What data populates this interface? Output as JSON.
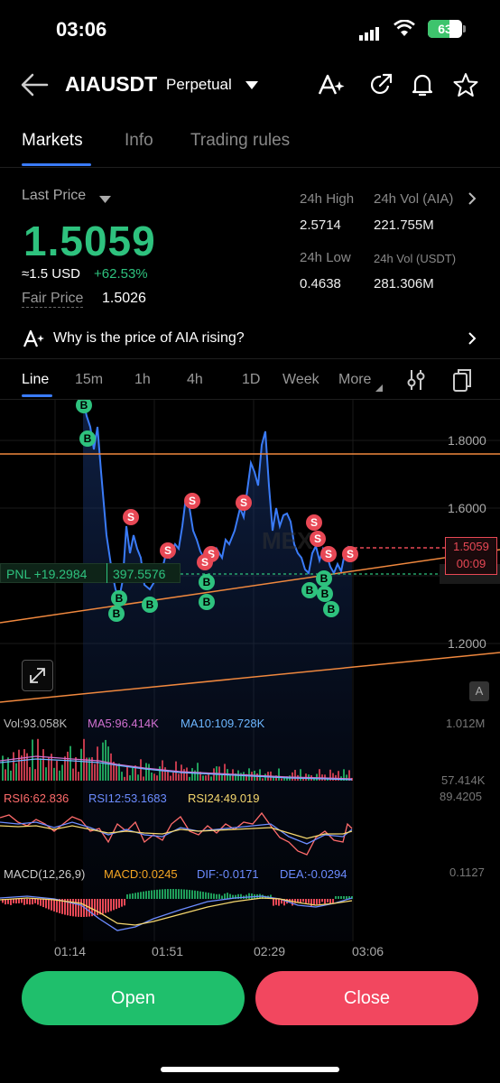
{
  "status": {
    "time": "03:06",
    "battery": "63",
    "battery_level": 0.63
  },
  "header": {
    "symbol": "AIAUSDT",
    "contract_type": "Perpetual"
  },
  "tabs": [
    "Markets",
    "Info",
    "Trading rules"
  ],
  "market": {
    "last_price_label": "Last Price",
    "last_price": "1.5059",
    "approx_usd": "≈1.5  USD",
    "change_pct": "+62.53%",
    "fair_price_label": "Fair Price",
    "fair_price": "1.5026",
    "high_label": "24h High",
    "high": "2.5714",
    "low_label": "24h Low",
    "low": "0.4638",
    "vol_aia_label": "24h Vol (AIA)",
    "vol_aia": "221.755M",
    "vol_usdt_label": "24h Vol  (USDT)",
    "vol_usdt": "281.306M"
  },
  "why_banner": "Why is the price of AIA rising?",
  "intervals": [
    "Line",
    "15m",
    "1h",
    "4h",
    "1D",
    "Week",
    "More"
  ],
  "chart": {
    "price_axis": [
      "1.8000",
      "1.6000",
      "1.2000"
    ],
    "price_tag_top": "1.5059",
    "price_tag_bottom": "00:09",
    "pnl": "PNL +19.2984",
    "entry_price": "397.5576",
    "mode_badge": "A",
    "vol_header": {
      "vol": "Vol:93.058K",
      "ma5": "MA5:96.414K",
      "ma10": "MA10:109.728K"
    },
    "vol_axis_top": "1.012M",
    "vol_axis_bottom": "57.414K",
    "rsi_header": {
      "rsi6": "RSI6:62.836",
      "rsi12": "RSI12:53.1683",
      "rsi24": "RSI24:49.019"
    },
    "rsi_axis_top": "89.4205",
    "macd_header": {
      "name": "MACD(12,26,9)",
      "macd": "MACD:0.0245",
      "dif": "DIF:-0.0171",
      "dea": "DEA:-0.0294"
    },
    "macd_axis_top": "0.1127",
    "time_axis": [
      "01:14",
      "01:51",
      "02:29",
      "03:06"
    ],
    "colors": {
      "line": "#3a7bf7",
      "buy": "#2ec27e",
      "sell": "#e84855",
      "trend": "#f0883e"
    }
  },
  "actions": {
    "open": "Open",
    "close": "Close"
  },
  "icons": [
    "back-arrow-icon",
    "caret-down-icon",
    "translate-icon",
    "share-icon",
    "bell-icon",
    "star-icon",
    "sparkle-icon",
    "chevron-right-icon",
    "indicator-settings-icon",
    "copy-icon",
    "expand-icon"
  ]
}
